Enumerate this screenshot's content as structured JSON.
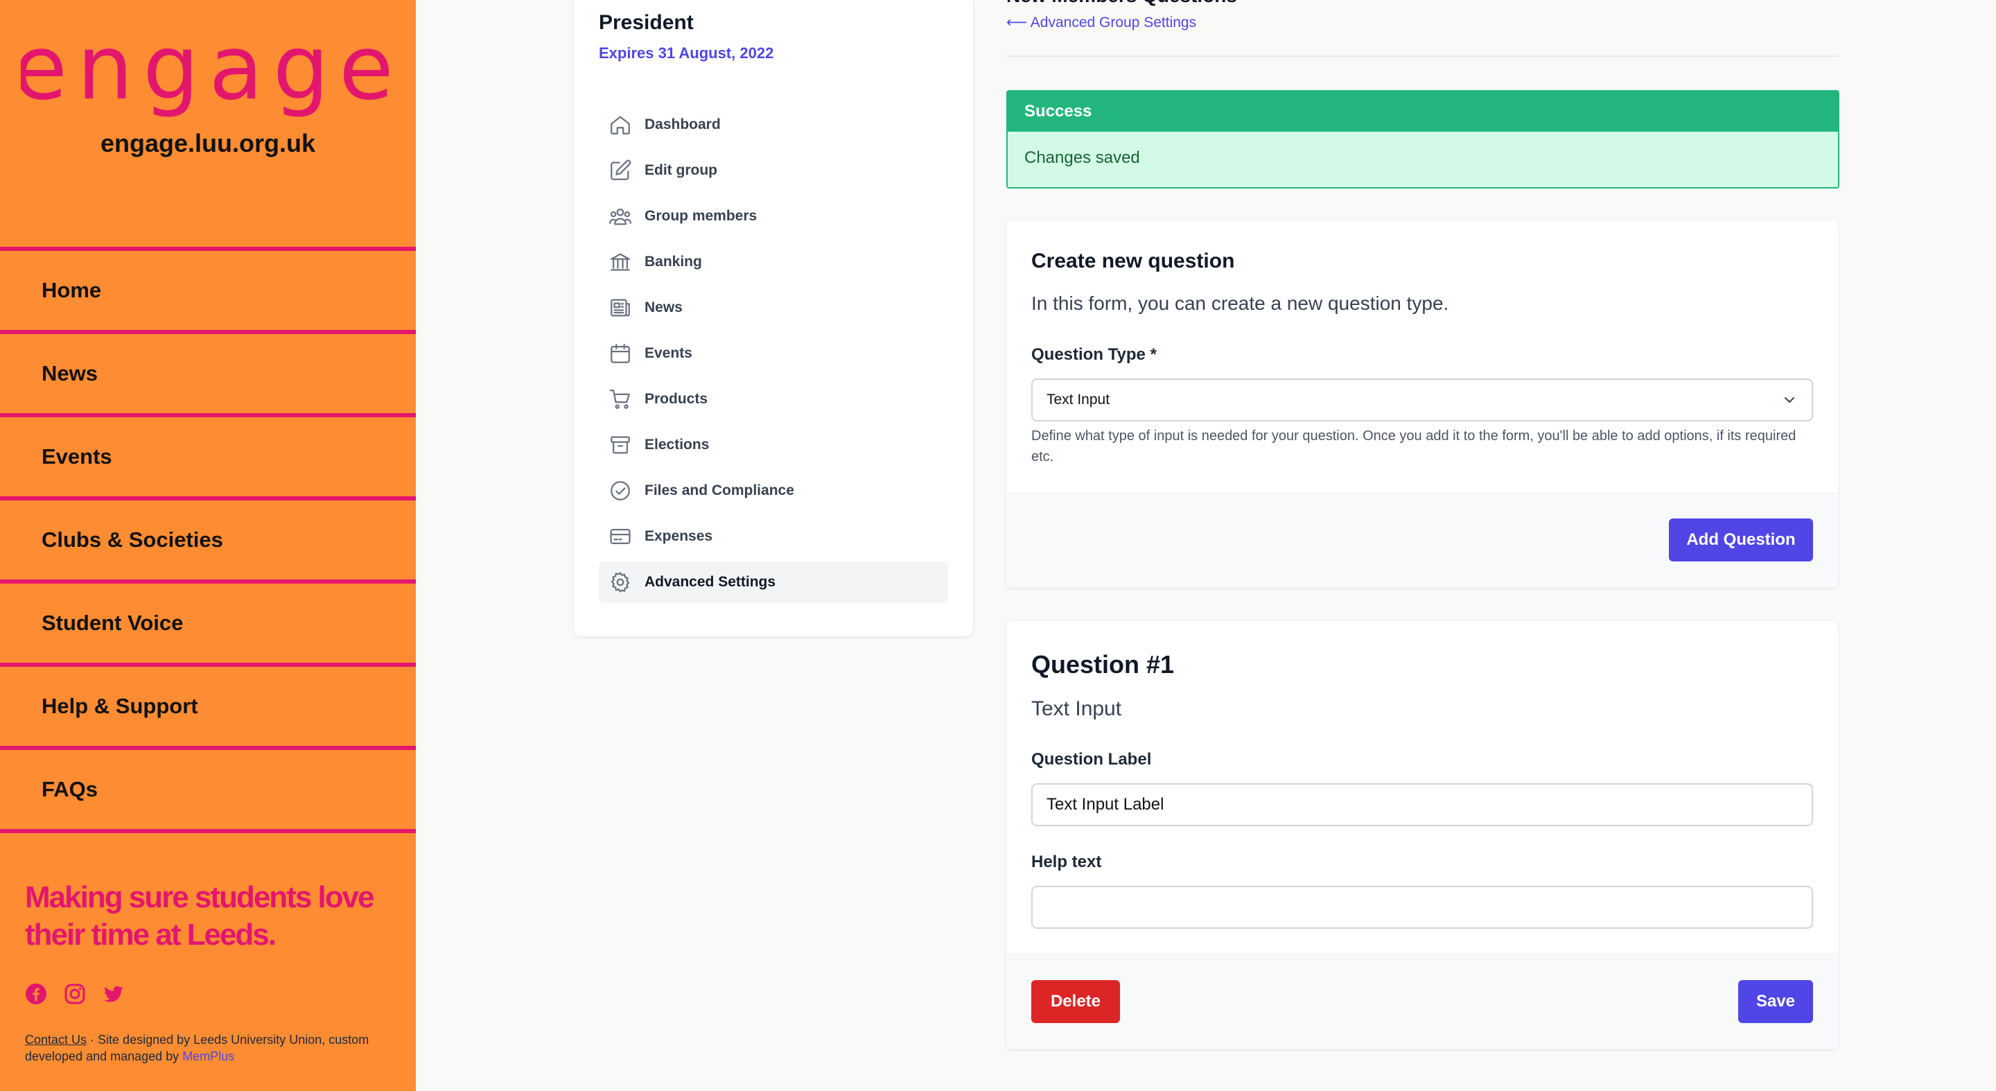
{
  "brand": {
    "logo_text": "engage",
    "site_url": "engage.luu.org.uk",
    "pink": "#e3166e",
    "orange": "#fd8c33"
  },
  "nav": {
    "items": [
      "Home",
      "News",
      "Events",
      "Clubs & Societies",
      "Student Voice",
      "Help & Support",
      "FAQs"
    ]
  },
  "footer": {
    "tagline": "Making sure students love their time at Leeds.",
    "socials": [
      "facebook-icon",
      "instagram-icon",
      "twitter-icon"
    ],
    "contact_link": "Contact Us",
    "credit_text": " · Site designed by Leeds University Union, custom developed and managed by ",
    "memplus_link": "MemPlus"
  },
  "group": {
    "title": "President",
    "expiry": "Expires 31 August, 2022",
    "menu": [
      {
        "label": "Dashboard",
        "icon": "home-icon"
      },
      {
        "label": "Edit group",
        "icon": "pencil-square-icon"
      },
      {
        "label": "Group members",
        "icon": "users-icon"
      },
      {
        "label": "Banking",
        "icon": "bank-icon"
      },
      {
        "label": "News",
        "icon": "newspaper-icon"
      },
      {
        "label": "Events",
        "icon": "calendar-icon"
      },
      {
        "label": "Products",
        "icon": "cart-icon"
      },
      {
        "label": "Elections",
        "icon": "archive-box-icon"
      },
      {
        "label": "Files and Compliance",
        "icon": "check-circle-icon"
      },
      {
        "label": "Expenses",
        "icon": "credit-card-icon"
      },
      {
        "label": "Advanced Settings",
        "icon": "gear-icon",
        "active": true
      }
    ]
  },
  "main": {
    "heading": "New Members Questions",
    "back_link": "⟵ Advanced Group Settings",
    "alert": {
      "title": "Success",
      "message": "Changes saved",
      "color": "#22b67e"
    },
    "create": {
      "title": "Create new question",
      "subtitle": "In this form, you can create a new question type.",
      "type_label": "Question Type *",
      "type_value": "Text Input",
      "help": "Define what type of input is needed for your question. Once you add it to the form, you'll be able to add options, if its required etc.",
      "add_button": "Add Question"
    },
    "question1": {
      "title": "Question #1",
      "type": "Text Input",
      "label_field": "Question Label",
      "label_value": "Text Input Label",
      "help_field": "Help text",
      "help_value": "",
      "delete_button": "Delete",
      "save_button": "Save"
    }
  }
}
